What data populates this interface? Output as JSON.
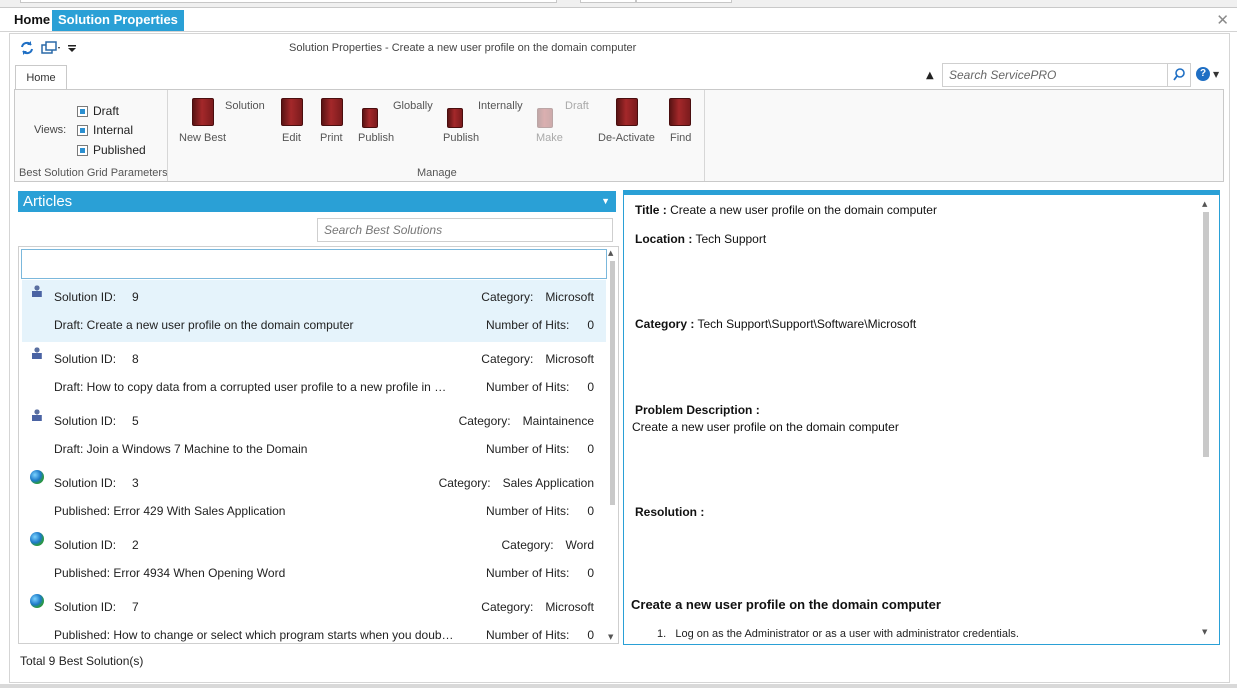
{
  "tabs": {
    "home": "Home",
    "active": "Solution Properties",
    "close": "✕"
  },
  "window_title": "Solution Properties -  Create a new user profile on the domain computer",
  "ribbon": {
    "tab_label": "Home",
    "search_placeholder": "Search ServicePRO",
    "help": "?",
    "views_label": "Views:",
    "views": [
      "Draft",
      "Internal",
      "Published"
    ],
    "group_grid_params": "Best Solution Grid Parameters",
    "group_manage": "Manage",
    "buttons": {
      "new_best_top": "Solution",
      "new_best": "New Best",
      "edit": "Edit",
      "print": "Print",
      "publish_globally_top": "Globally",
      "publish_globally": "Publish",
      "publish_internally_top": "Internally",
      "publish_internally": "Publish",
      "make_draft_top": "Draft",
      "make_draft": "Make",
      "deactivate": "De-Activate",
      "find": "Find"
    }
  },
  "articles": {
    "header": "Articles",
    "search_placeholder": "Search Best Solutions",
    "id_label": "Solution ID:",
    "category_label": "Category:",
    "hits_label": "Number of Hits:",
    "items": [
      {
        "icon": "user-icon",
        "id": "9",
        "category": "Microsoft",
        "title": "Draft: Create a new user profile on the domain computer",
        "hits": "0"
      },
      {
        "icon": "user-icon",
        "id": "8",
        "category": "Microsoft",
        "title": "Draft: How to copy data from a corrupted user profile to a new profile in Windows",
        "hits": "0"
      },
      {
        "icon": "user-icon",
        "id": "5",
        "category": "Maintainence",
        "title": "Draft: Join a Windows 7 Machine to the Domain",
        "hits": "0"
      },
      {
        "icon": "globe-icon",
        "id": "3",
        "category": "Sales Application",
        "title": "Published: Error 429 With Sales Application",
        "hits": "0"
      },
      {
        "icon": "globe-icon",
        "id": "2",
        "category": "Word",
        "title": "Published: Error 4934 When Opening Word",
        "hits": "0"
      },
      {
        "icon": "globe-icon",
        "id": "7",
        "category": "Microsoft",
        "title": "Published: How to change or select which program starts when you double-click a file",
        "hits": "0"
      }
    ],
    "total": "Total 9 Best Solution(s)"
  },
  "detail": {
    "title_label": "Title :",
    "title_value": "Create a new user profile on the domain computer",
    "location_label": "Location :",
    "location_value": "Tech Support",
    "category_label": "Category :",
    "category_value": "Tech Support\\Support\\Software\\Microsoft",
    "problem_label": "Problem Description :",
    "problem_value": "Create a new user profile on the domain computer",
    "resolution_label": "Resolution :",
    "heading": "Create a new user profile on the domain computer",
    "step1_num": "1.",
    "step1": "Log on as the Administrator or as a user with administrator credentials."
  },
  "colors": {
    "accent": "#2aa0d6",
    "selected_row": "#e5f3fb"
  }
}
